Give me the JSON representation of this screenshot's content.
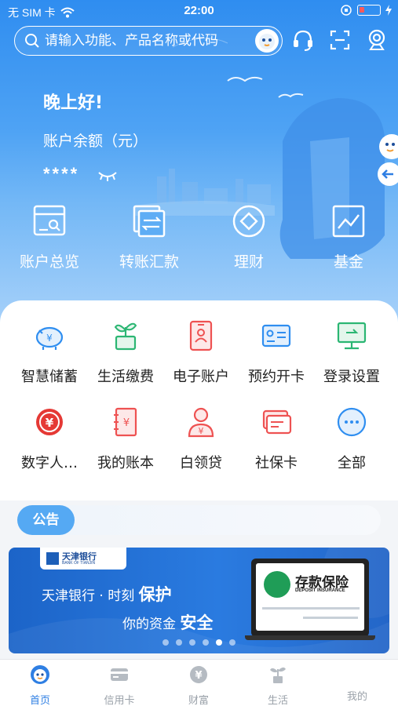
{
  "status_bar": {
    "carrier": "无 SIM 卡",
    "time": "22:00"
  },
  "search": {
    "placeholder": "请输入功能、产品名称或代码"
  },
  "header_icons": [
    "headset-icon",
    "scan-icon",
    "camera-icon"
  ],
  "account": {
    "greeting": "晚上好!",
    "balance_label": "账户余额（元）",
    "balance_masked": "****"
  },
  "quick_actions": [
    {
      "label": "账户总览",
      "icon": "account-overview-icon"
    },
    {
      "label": "转账汇款",
      "icon": "transfer-icon"
    },
    {
      "label": "理财",
      "icon": "wealth-icon"
    },
    {
      "label": "基金",
      "icon": "fund-chart-icon"
    }
  ],
  "services": [
    {
      "label": "智慧储蓄",
      "icon": "piggy-bank-icon",
      "color": "#2f8ef0"
    },
    {
      "label": "生活缴费",
      "icon": "plant-icon",
      "color": "#2bb673"
    },
    {
      "label": "电子账户",
      "icon": "e-account-icon",
      "color": "#ee5252"
    },
    {
      "label": "预约开卡",
      "icon": "card-appointment-icon",
      "color": "#2f8ef0"
    },
    {
      "label": "登录设置",
      "icon": "monitor-login-icon",
      "color": "#2bb673"
    },
    {
      "label": "数字人…",
      "icon": "digital-rmb-icon",
      "color": "#e53935"
    },
    {
      "label": "我的账本",
      "icon": "ledger-icon",
      "color": "#ee5252"
    },
    {
      "label": "白领贷",
      "icon": "loan-icon",
      "color": "#ee5252"
    },
    {
      "label": "社保卡",
      "icon": "social-security-card-icon",
      "color": "#ee5252"
    },
    {
      "label": "全部",
      "icon": "more-icon",
      "color": "#2f8ef0"
    }
  ],
  "notice": {
    "label": "公告"
  },
  "banner": {
    "bank_name_cn": "天津银行",
    "bank_name_en": "BANK OF TIANJIN",
    "line1_prefix": "天津银行 · 时刻",
    "line1_emphasis": "保护",
    "line2_prefix": "你的资金",
    "line2_emphasis": "安全",
    "insurance_title": "存款保险",
    "insurance_subtitle": "DEPOSIT INSURANCE",
    "slide_count": 6,
    "active_slide": 5
  },
  "tab_bar": [
    {
      "label": "首页",
      "icon": "home-mascot-icon",
      "active": true
    },
    {
      "label": "信用卡",
      "icon": "credit-card-icon",
      "active": false
    },
    {
      "label": "财富",
      "icon": "yuan-coin-icon",
      "active": false
    },
    {
      "label": "生活",
      "icon": "sprout-icon",
      "active": false
    },
    {
      "label": "我的",
      "icon": "profile-icon",
      "active": false
    }
  ],
  "colors": {
    "brand_blue": "#2f8ef0",
    "active_tab": "#2f7fe3",
    "inactive_tab": "#9aa1a9"
  }
}
